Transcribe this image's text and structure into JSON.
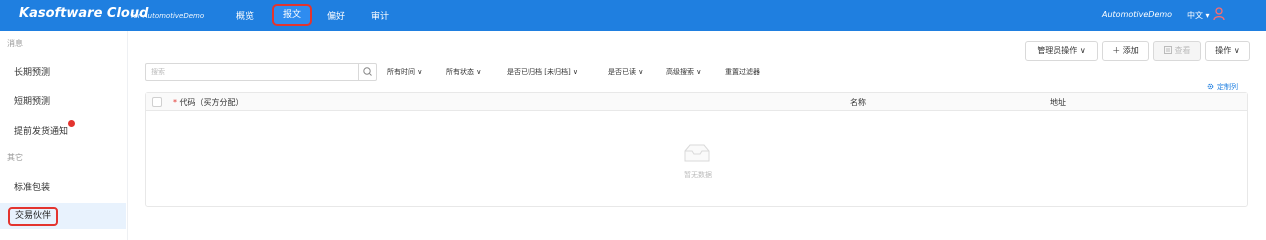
{
  "header": {
    "brand": "Kasoftware Cloud",
    "brand_sub": "for AutomotiveDemo",
    "nav": [
      "概览",
      "报文",
      "偏好",
      "审计"
    ],
    "account": "AutomotiveDemo",
    "language": "中文 ▾"
  },
  "sidebar": {
    "group1": "消息",
    "items1": [
      "长期预测",
      "短期预测",
      "提前发货通知"
    ],
    "group2": "其它",
    "items2": [
      "标准包装",
      "交易伙伴"
    ]
  },
  "actions": {
    "admin": "管理员操作 ∨",
    "add": "＋ 添加",
    "view": "查看",
    "ops": "操作 ∨"
  },
  "filters": {
    "search_placeholder": "搜索",
    "time": "所有时间 ∨",
    "status": "所有状态 ∨",
    "archived": "是否已归档 [未归档] ∨",
    "read": "是否已读 ∨",
    "advanced": "高级搜索 ∨",
    "reset": "重置过滤器"
  },
  "customize_columns": "定制列",
  "table": {
    "columns": [
      "代码（买方分配）",
      "名称",
      "地址"
    ],
    "empty_text": "暂无数据"
  },
  "colors": {
    "primary": "#1f7fe0",
    "highlight": "#e3342f"
  }
}
